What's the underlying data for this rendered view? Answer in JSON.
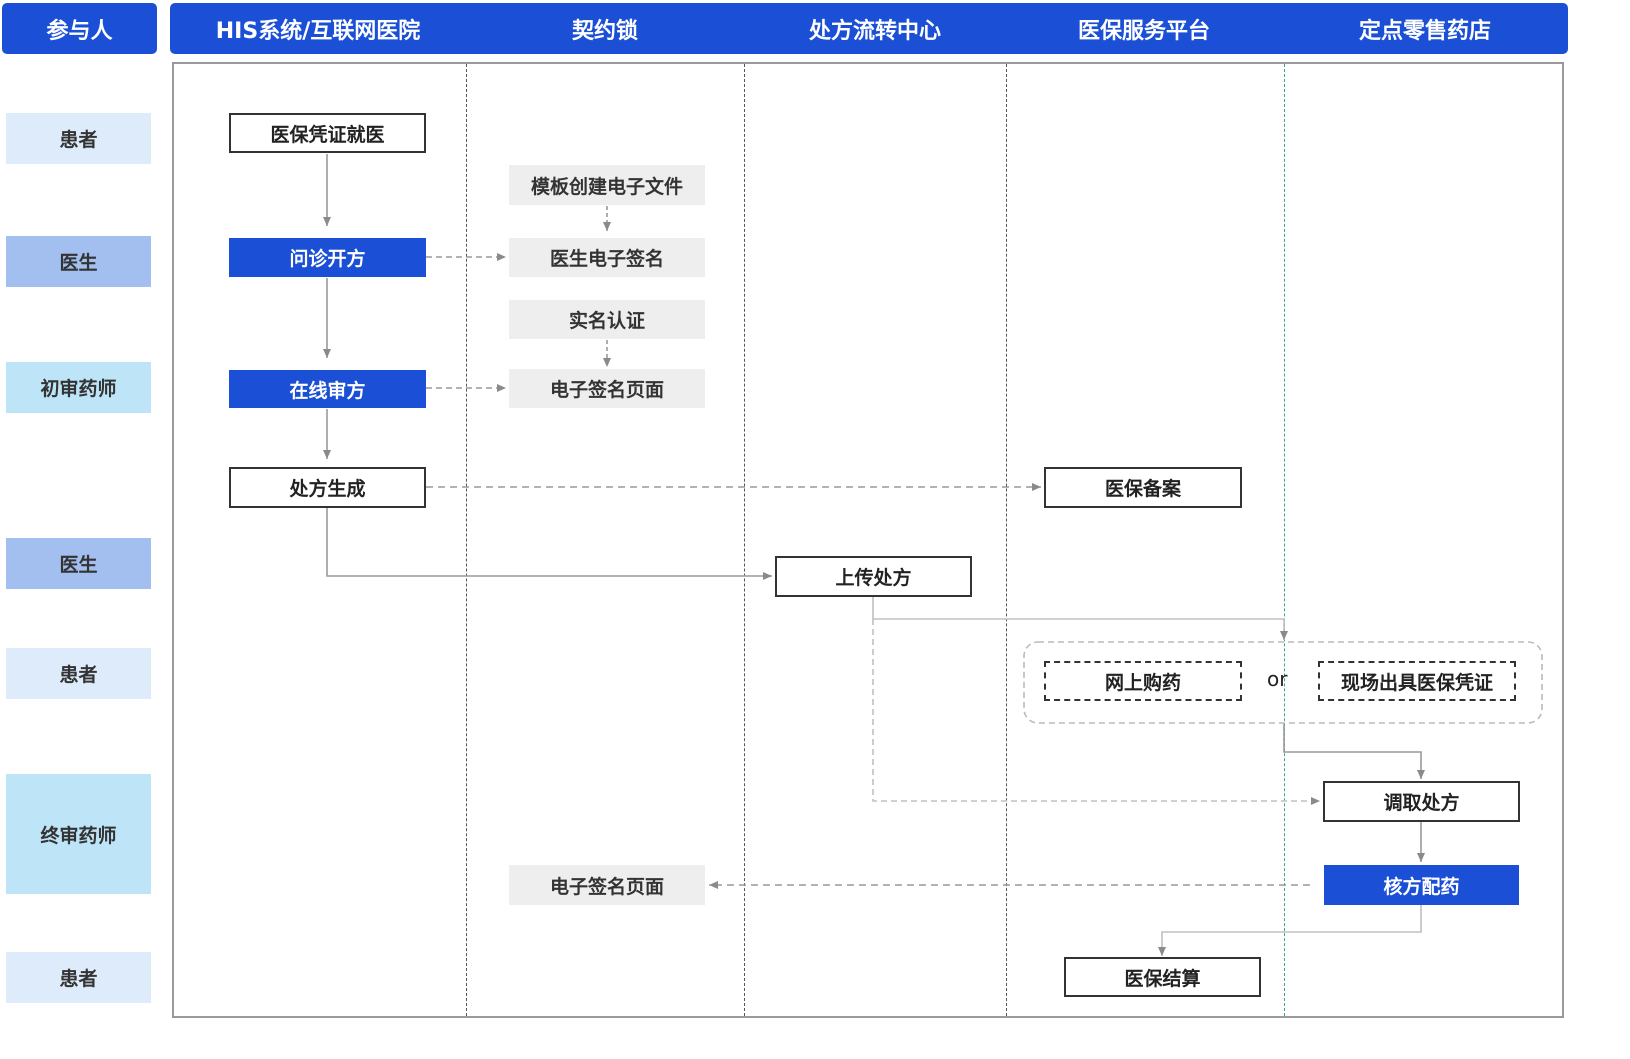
{
  "header": {
    "left": "参与人",
    "columns": [
      "HIS系统/互联网医院",
      "契约锁",
      "处方流转中心",
      "医保服务平台",
      "定点零售药店"
    ]
  },
  "roles": [
    {
      "label": "患者",
      "color": "#deebfb"
    },
    {
      "label": "医生",
      "color": "#a3bff0"
    },
    {
      "label": "初审药师",
      "color": "#bde4f7"
    },
    {
      "label": "医生",
      "color": "#a3bff0"
    },
    {
      "label": "患者",
      "color": "#deebfb"
    },
    {
      "label": "终审药师",
      "color": "#bde4f7"
    },
    {
      "label": "患者",
      "color": "#deebfb"
    }
  ],
  "nodes": {
    "his_1": "医保凭证就医",
    "his_2": "问诊开方",
    "his_3": "在线审方",
    "his_4": "处方生成",
    "qys_1": "模板创建电子文件",
    "qys_2": "医生电子签名",
    "qys_3": "实名认证",
    "qys_4": "电子签名页面",
    "qys_5": "电子签名页面",
    "cf_1": "上传处方",
    "yb_1": "医保备案",
    "yb_2": "网上购药",
    "yb_3": "医保结算",
    "yd_1": "现场出具医保凭证",
    "yd_2": "调取处方",
    "yd_3": "核方配药",
    "or_label": "or"
  },
  "colors": {
    "header_blue": "#1a4fd6",
    "accent_blue": "#1a4fd6",
    "gray_box": "#eeeeee",
    "connector": "#9a9a9a",
    "green_divider": "#3aa58c"
  }
}
